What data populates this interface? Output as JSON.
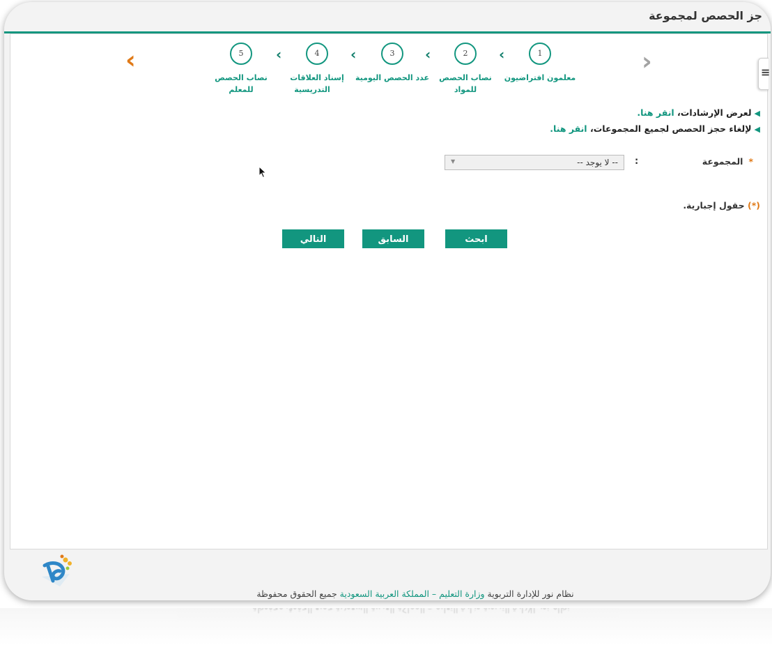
{
  "page": {
    "title": "جز الحصص لمجموعة"
  },
  "wizard": {
    "steps": [
      {
        "number": "1",
        "label": "معلمون افتراضيون"
      },
      {
        "number": "2",
        "label": "نصاب الحصص للمواد"
      },
      {
        "number": "3",
        "label": "عدد الحصص اليومية"
      },
      {
        "number": "4",
        "label_line1": "إسناد العلاقات",
        "label_line2": "التدريسية"
      },
      {
        "number": "5",
        "label_line1": "نصاب الحصص",
        "label_line2": "للمعلم"
      }
    ],
    "prev_icon": "chevron-right-icon",
    "next_icon": "chevron-left-icon",
    "separator_icon": "chevron-left-icon"
  },
  "guides": {
    "show_instructions_text": "لعرض الإرشادات،",
    "show_instructions_link": "انقر هنا.",
    "cancel_all_text": "لإلغاء حجز الحصص لجميع المجموعات،",
    "cancel_all_link": "انقر هنا."
  },
  "form": {
    "group_label": "المجموعة",
    "required_mark": "*",
    "colon": ":",
    "group_selected": "-- لا يوجد --",
    "mandatory_note_mark": "(*)",
    "mandatory_note_text": "حقول إجبارية."
  },
  "buttons": {
    "search": "ابحث",
    "previous": "السابق",
    "next": "التالي"
  },
  "footer": {
    "part1": "نظام نور للإدارة التربوية",
    "part2": "وزارة التعليم – المملكة العربية السعودية",
    "part3": "جميع الحقوق محفوظة"
  },
  "colors": {
    "accent": "#12967f",
    "orange": "#e07a18",
    "gray_arrow": "#a3a3a3"
  }
}
